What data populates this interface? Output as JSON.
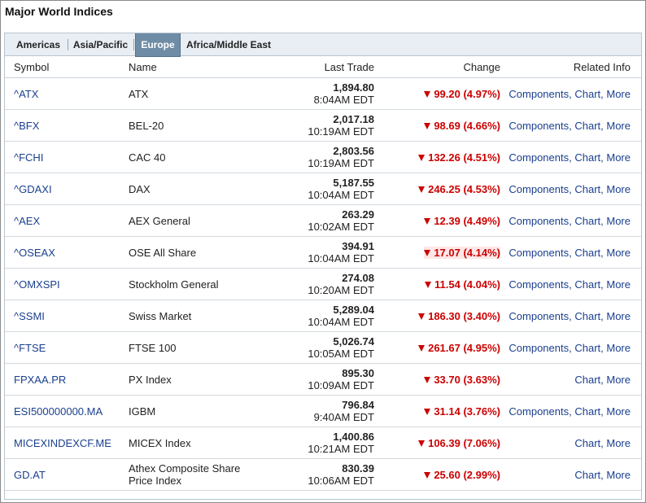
{
  "title": "Major World Indices",
  "tabs": [
    {
      "label": "Americas",
      "active": false
    },
    {
      "label": "Asia/Pacific",
      "active": false
    },
    {
      "label": "Europe",
      "active": true
    },
    {
      "label": "Africa/Middle East",
      "active": false
    }
  ],
  "columns": {
    "symbol": "Symbol",
    "name": "Name",
    "last_trade": "Last Trade",
    "change": "Change",
    "related": "Related Info"
  },
  "colors": {
    "down": "#cc0000",
    "link": "#1a3f8f",
    "active_tab": "#6f8ca6"
  },
  "related_labels": {
    "components": "Components",
    "chart": "Chart",
    "more": "More"
  },
  "rows": [
    {
      "symbol": "^ATX",
      "name": "ATX",
      "price": "1,894.80",
      "time": "8:04AM EDT",
      "change": "99.20 (4.97%)",
      "direction": "down",
      "links": [
        "components",
        "chart",
        "more"
      ]
    },
    {
      "symbol": "^BFX",
      "name": "BEL-20",
      "price": "2,017.18",
      "time": "10:19AM EDT",
      "change": "98.69 (4.66%)",
      "direction": "down",
      "links": [
        "components",
        "chart",
        "more"
      ]
    },
    {
      "symbol": "^FCHI",
      "name": "CAC 40",
      "price": "2,803.56",
      "time": "10:19AM EDT",
      "change": "132.26 (4.51%)",
      "direction": "down",
      "links": [
        "components",
        "chart",
        "more"
      ]
    },
    {
      "symbol": "^GDAXI",
      "name": "DAX",
      "price": "5,187.55",
      "time": "10:04AM EDT",
      "change": "246.25 (4.53%)",
      "direction": "down",
      "links": [
        "components",
        "chart",
        "more"
      ]
    },
    {
      "symbol": "^AEX",
      "name": "AEX General",
      "price": "263.29",
      "time": "10:02AM EDT",
      "change": "12.39 (4.49%)",
      "direction": "down",
      "links": [
        "components",
        "chart",
        "more"
      ]
    },
    {
      "symbol": "^OSEAX",
      "name": "OSE All Share",
      "price": "394.91",
      "time": "10:04AM EDT",
      "change": "17.07 (4.14%)",
      "direction": "down",
      "highlight": true,
      "links": [
        "components",
        "chart",
        "more"
      ]
    },
    {
      "symbol": "^OMXSPI",
      "name": "Stockholm General",
      "price": "274.08",
      "time": "10:20AM EDT",
      "change": "11.54 (4.04%)",
      "direction": "down",
      "links": [
        "components",
        "chart",
        "more"
      ]
    },
    {
      "symbol": "^SSMI",
      "name": "Swiss Market",
      "price": "5,289.04",
      "time": "10:04AM EDT",
      "change": "186.30 (3.40%)",
      "direction": "down",
      "links": [
        "components",
        "chart",
        "more"
      ]
    },
    {
      "symbol": "^FTSE",
      "name": "FTSE 100",
      "price": "5,026.74",
      "time": "10:05AM EDT",
      "change": "261.67 (4.95%)",
      "direction": "down",
      "links": [
        "components",
        "chart",
        "more"
      ]
    },
    {
      "symbol": "FPXAA.PR",
      "name": "PX Index",
      "price": "895.30",
      "time": "10:09AM EDT",
      "change": "33.70 (3.63%)",
      "direction": "down",
      "links": [
        "chart",
        "more"
      ]
    },
    {
      "symbol": "ESI500000000.MA",
      "name": "IGBM",
      "price": "796.84",
      "time": "9:40AM EDT",
      "change": "31.14 (3.76%)",
      "direction": "down",
      "links": [
        "components",
        "chart",
        "more"
      ]
    },
    {
      "symbol": "MICEXINDEXCF.ME",
      "name": "MICEX Index",
      "price": "1,400.86",
      "time": "10:21AM EDT",
      "change": "106.39 (7.06%)",
      "direction": "down",
      "links": [
        "chart",
        "more"
      ]
    },
    {
      "symbol": "GD.AT",
      "name": "Athex Composite Share Price Index",
      "price": "830.39",
      "time": "10:06AM EDT",
      "change": "25.60 (2.99%)",
      "direction": "down",
      "links": [
        "chart",
        "more"
      ]
    }
  ]
}
